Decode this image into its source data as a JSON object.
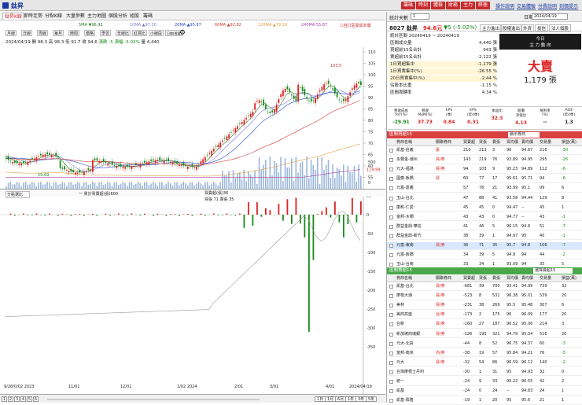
{
  "app": {
    "icon": "stock-icon",
    "stock_name": "鈦昇",
    "color_red": "#c8292c",
    "color_green": "#1a8a1a"
  },
  "top_buttons": [
    "籌碼",
    "時刻",
    "體檢",
    "財務",
    "主力",
    "終極"
  ],
  "top_links": [
    "操作說明",
    "交易體驗",
    "付費說明",
    "到價提示"
  ],
  "chart_tabs": [
    "鈦昇K線",
    "即時走勢",
    "分點K線",
    "大量參數",
    "主力地圖",
    "個股分析",
    "組股",
    "籌碼"
  ],
  "ma_legend": [
    {
      "label": "5MA ▼96.92",
      "color": "#2a7a2a"
    },
    {
      "label": "10MA ▲97.20",
      "color": "#7a7adb"
    },
    {
      "label": "20MA ▲95.87",
      "color": "#2a4ad0"
    },
    {
      "label": "60MA ▲92.82",
      "color": "#d03a3a"
    },
    {
      "label": "120MA ▲79.18",
      "color": "#e0a040"
    },
    {
      "label": "240MA 55.87",
      "color": "#aa44aa"
    }
  ],
  "chart_note": "☐自訂區間成本價",
  "toolbar": [
    "月線",
    "日線",
    "周線",
    "每月",
    "時間",
    "價格",
    "學習",
    "年線比",
    "紅標比",
    "小線段",
    "日線(標選)"
  ],
  "ohlc": {
    "date": "2024/04/19",
    "open_label": "開",
    "open": "98.3",
    "high_label": "高",
    "high": "98.3",
    "low_label": "低",
    "low": "91.7",
    "close_label": "收",
    "close": "94.6",
    "change_label": "漲跌",
    "change": "-5",
    "pct_label": "漲幅",
    "pct": "-5.02%",
    "vol_label": "量",
    "vol": "4,440"
  },
  "price_axis": [
    "110",
    "105",
    "100",
    "95",
    "90",
    "85",
    "80",
    "75",
    "70",
    "65",
    "60",
    "55"
  ],
  "vol_axis": [
    "500",
    "0"
  ],
  "lower_axis": [
    "119.99",
    "50",
    "0",
    "-50",
    "-100",
    "-150",
    "-200",
    "-250",
    "-300",
    "-350"
  ],
  "lower_legend": {
    "left": "分點選比",
    "cum_label": "一 累計買賣超(張)600",
    "buy_label": "買賣超(張)36",
    "detail": "買張 71 賣張 35"
  },
  "chart_annotations": {
    "high_label": "103.5",
    "low_label": "59.69"
  },
  "x_axis": [
    "9/28/0/02\n2023",
    "11/01",
    "12/01",
    "1/02\n2024",
    "2/01",
    "3/01",
    "4/01",
    "2024/04/19"
  ],
  "pages": [
    "1",
    "2",
    "3",
    "4",
    "5",
    "6"
  ],
  "range_buttons": [
    "1日",
    "1月",
    "6月",
    "1年",
    "3年",
    "5年"
  ],
  "right": {
    "days_label": "統計天數",
    "days_value": "1",
    "date_label": "日期",
    "date_value": "2024/04/19",
    "stock_line": "8027 鈦昇",
    "price": "94.6元",
    "chg": "▼5 (-5.02%)",
    "subtabs": [
      "主力進出",
      "股權進出",
      "外資",
      "投信",
      "法人個股"
    ],
    "summary": [
      {
        "label": "統計區間 20240419 ~ 20240419",
        "value": ""
      },
      {
        "label": "區間成交量",
        "value": "4,440 張"
      },
      {
        "label": "買超前15名合計",
        "value": "943 張"
      },
      {
        "label": "賣超前15名合計",
        "value": "-2,122 張"
      },
      {
        "label": "1日買超集中",
        "value": "-1,179 張"
      },
      {
        "label": "1日買賣集中(%)",
        "value": "-26.55 %"
      },
      {
        "label": "20日買賣集中(%)",
        "value": "-2.44 %"
      },
      {
        "label": "佔股本比重",
        "value": "-1.15 %"
      },
      {
        "label": "區間周轉率",
        "value": "4.34 %"
      }
    ],
    "bigbox": {
      "title": "今日",
      "sub": "主 力 動 向",
      "verdict": "大賣",
      "amount": "1,179 張"
    },
    "kpi_heads": [
      "營收成長\nYoY(%)",
      "營收\nMoM(%)",
      "EPS\n(季)",
      "EPS\n(近4季)",
      "本益比",
      "股價\n淨值比",
      "殖利率\n(%)",
      "ROE\n(近4季)"
    ],
    "kpi_vals": [
      "-29.91",
      "37.73",
      "0.84",
      "0.31",
      "32.3",
      "4.13",
      "--",
      "1.3"
    ],
    "buy_title": "區間買超15",
    "buy_sel": "顯示券商",
    "cols": [
      "券商名稱",
      "關聯券商",
      "買賣超",
      "買張",
      "賣張",
      "買均價",
      "賣均價",
      "交易量",
      "損益(萬)"
    ],
    "buy_rows": [
      [
        "凱基-信義",
        "豪",
        "210",
        "213",
        "3",
        "96",
        "94.67",
        "216",
        "-30"
      ],
      [
        "永豐金-潮州",
        "買/券",
        "143",
        "219",
        "76",
        "93.89",
        "94.95",
        "295",
        "-26"
      ],
      [
        "元大-福港",
        "買/券",
        "94",
        "103",
        "9",
        "95.23",
        "94.89",
        "112",
        "-6"
      ],
      [
        "國泰-板橋",
        "買",
        "60",
        "77",
        "17",
        "95.61",
        "95.71",
        "94",
        "-6"
      ],
      [
        "元富-嘉義",
        "",
        "57",
        "78",
        "21",
        "93.99",
        "95.1",
        "99",
        "6"
      ],
      [
        "玉山-台北",
        "",
        "47",
        "88",
        "41",
        "93.58",
        "94.44",
        "129",
        "8"
      ],
      [
        "康和-仁愛",
        "",
        "45",
        "45",
        "0",
        "94.47",
        "--",
        "45",
        "1"
      ],
      [
        "富邦-木柵",
        "",
        "43",
        "43",
        "0",
        "94.77",
        "--",
        "43",
        "-1"
      ],
      [
        "群益金鼎-華信",
        "",
        "41",
        "46",
        "5",
        "96.15",
        "94.6",
        "51",
        "-7"
      ],
      [
        "群益金鼎-新竹",
        "",
        "38",
        "39",
        "1",
        "94.97",
        "95",
        "40",
        "-1"
      ],
      [
        "元富-東南",
        "買/券",
        "36",
        "71",
        "35",
        "95.7",
        "94.8",
        "106",
        "-7"
      ],
      [
        "元富-板橋",
        "",
        "34",
        "39",
        "5",
        "94.9",
        "94",
        "44",
        "-2"
      ],
      [
        "玉山-台南",
        "",
        "33",
        "34",
        "1",
        "93.09",
        "94",
        "35",
        "5"
      ]
    ],
    "sell_title": "區間賣超15",
    "sell_sel": "選擇賣超15",
    "sell_rows": [
      [
        "凱基-台北",
        "買/券",
        "-681",
        "39",
        "700",
        "93.41",
        "94.99",
        "739",
        "32"
      ],
      [
        "摩根大通",
        "買/券",
        "-523",
        "8",
        "531",
        "96.38",
        "95.01",
        "539",
        "20"
      ],
      [
        "美林",
        "買/券",
        "-231",
        "38",
        "269",
        "95.5",
        "95.48",
        "307",
        "6"
      ],
      [
        "美商高盛",
        "台/券",
        "-173",
        "2",
        "175",
        "96",
        "96.09",
        "177",
        "20"
      ],
      [
        "台新",
        "買/券",
        "-160",
        "27",
        "187",
        "96.52",
        "95.06",
        "214",
        "3"
      ],
      [
        "新加坡商瑞銀",
        "買/券",
        "-126",
        "195",
        "321",
        "94.79",
        "95.34",
        "516",
        "20"
      ],
      [
        "元大-北投",
        "",
        "-44",
        "8",
        "52",
        "96.75",
        "94.37",
        "60",
        "-3"
      ],
      [
        "富邦-南京",
        "內/券",
        "-38",
        "19",
        "57",
        "95.84",
        "94.21",
        "76",
        "-5"
      ],
      [
        "元大",
        "買/券",
        "-32",
        "54",
        "86",
        "96.59",
        "96.12",
        "140",
        "-2"
      ],
      [
        "台灣摩根士丹利",
        "",
        "-30",
        "1",
        "31",
        "95",
        "94.93",
        "32",
        "0"
      ],
      [
        "統一",
        "",
        "-24",
        "9",
        "33",
        "99.22",
        "96.55",
        "42",
        "2"
      ],
      [
        "凱基",
        "",
        "-24",
        "0",
        "24",
        "--",
        "94.83",
        "24",
        "1"
      ],
      [
        "凱基-興隆",
        "",
        "-19",
        "1",
        "20",
        "95",
        "95.6",
        "21",
        "1"
      ]
    ]
  }
}
